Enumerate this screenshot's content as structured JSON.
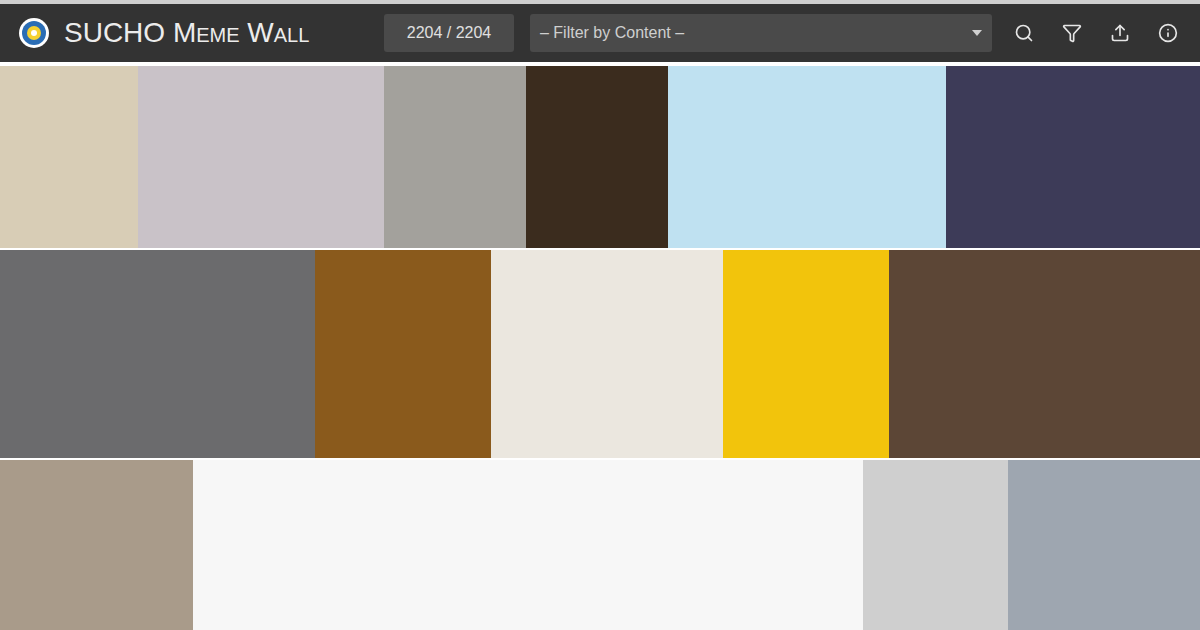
{
  "header": {
    "title": "SUCHO Meme Wall",
    "counter": "2204 / 2204",
    "filter": {
      "placeholder": "– Filter by Content –"
    }
  },
  "wall": {
    "rows": [
      [
        {
          "color": "#d8cdb6"
        },
        {
          "color": "#c9c2c8"
        },
        {
          "color": "#a3a19c"
        },
        {
          "color": "#3b2c1e"
        },
        {
          "color": "#bfe1f1"
        },
        {
          "color": "#3d3b58"
        }
      ],
      [
        {
          "color": "#6b6b6d"
        },
        {
          "color": "#8a5a1c"
        },
        {
          "color": "#ebe7df"
        },
        {
          "color": "#f2c40c"
        },
        {
          "color": "#5c4636"
        }
      ],
      [
        {
          "color": "#a99b8a"
        },
        {
          "color": "#f7f7f7"
        },
        {
          "color": "#cfcfcf"
        },
        {
          "color": "#9ea6b0"
        }
      ]
    ]
  }
}
